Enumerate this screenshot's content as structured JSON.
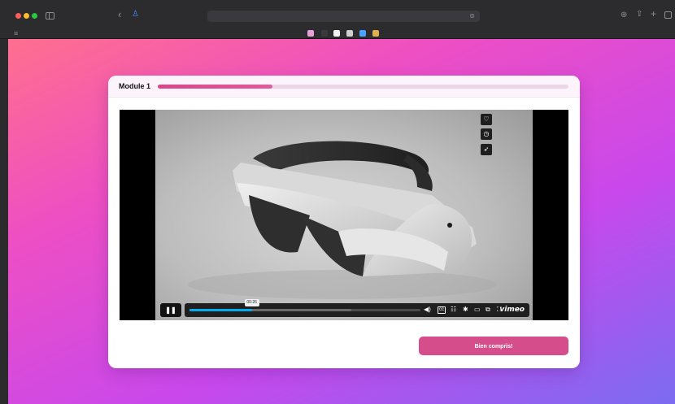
{
  "browser": {
    "address_value": "",
    "favorites": [
      {
        "name": "fav-1",
        "color": "#e8a0d8"
      },
      {
        "name": "fav-2",
        "color": "#3a3a3e"
      },
      {
        "name": "fav-3",
        "color": "#f2f2f2"
      },
      {
        "name": "fav-4",
        "color": "#cfcfcf"
      },
      {
        "name": "fav-5",
        "color": "#4aa3ff"
      },
      {
        "name": "fav-6",
        "color": "#e0b050"
      }
    ]
  },
  "course": {
    "module_title": "Module 1",
    "progress_fraction": 0.28,
    "progress_color": "#d9478a"
  },
  "video": {
    "current_time": "00:26",
    "played_fraction": 0.27,
    "logo": "vimeo",
    "side_icons": [
      "heart-icon",
      "clock-icon",
      "send-icon"
    ],
    "control_icons": [
      "volume-icon",
      "captions-icon",
      "transcript-icon",
      "settings-icon",
      "airplay-icon",
      "pip-icon",
      "fullscreen-icon"
    ]
  },
  "cta": {
    "label": "Bien compris!",
    "color": "#d64d8c"
  },
  "theme": {
    "gradient_start": "#ff6f8e",
    "gradient_end": "#7b6cf1"
  }
}
